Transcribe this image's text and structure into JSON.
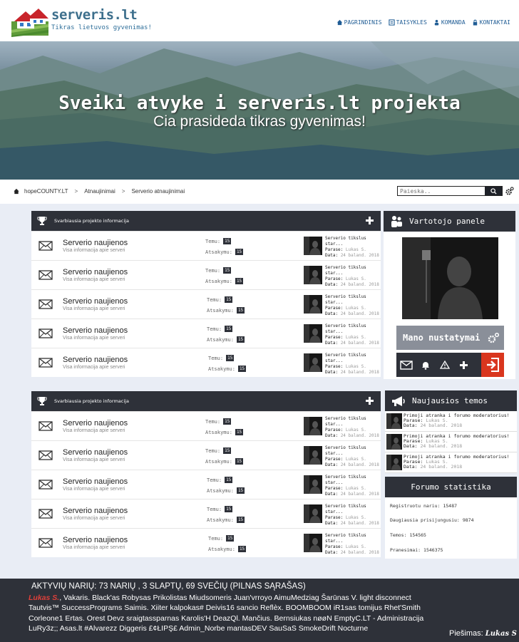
{
  "header": {
    "brand": "serveris.lt",
    "tagline": "Tikras lietuvos gyvenimas!",
    "nav": [
      {
        "label": "PAGRINDINIS",
        "icon": "home-icon"
      },
      {
        "label": "TAISYKLES",
        "icon": "rules-icon"
      },
      {
        "label": "KOMANDA",
        "icon": "team-icon"
      },
      {
        "label": "KONTAKTAI",
        "icon": "lock-icon"
      }
    ]
  },
  "hero": {
    "title": "Sveiki atvyke i serveris.lt projekta",
    "subtitle": "Cia prasideda tikras gyvenimas!"
  },
  "breadcrumb": [
    "hopeCOUNTY.LT",
    "Atnaujinimai",
    "Serverio atnaujinimai"
  ],
  "search": {
    "placeholder": "Paieska.."
  },
  "blocks": [
    {
      "title": "Svarbiausia projekto informacija",
      "rows": [
        {
          "title": "Serverio naujienos",
          "desc": "Visa informacija apie serveri",
          "topics_label": "Temu:",
          "topics": "15",
          "replies_label": "Atsakymu:",
          "replies": "15",
          "last_title": "Serverio tikslus star...",
          "by_label": "Parase:",
          "by": "Lukas S.",
          "date_label": "Data:",
          "date": "24 baland. 2018"
        },
        {
          "title": "Serverio naujienos",
          "desc": "Visa informacija apie serveri",
          "topics_label": "Temu:",
          "topics": "15",
          "replies_label": "Atsakymu:",
          "replies": "15",
          "last_title": "Serverio tikslus star...",
          "by_label": "Parase:",
          "by": "Lukas S.",
          "date_label": "Data:",
          "date": "24 baland. 2018"
        },
        {
          "title": "Serverio naujienos",
          "desc": "Visa informacija apie serveri",
          "topics_label": "Temu:",
          "topics": "15",
          "replies_label": "Atsakymu:",
          "replies": "15",
          "last_title": "Serverio tikslus star...",
          "by_label": "Parase:",
          "by": "Lukas S.",
          "date_label": "Data:",
          "date": "24 baland. 2018"
        },
        {
          "title": "Serverio naujienos",
          "desc": "Visa informacija apie serveri",
          "topics_label": "Temu:",
          "topics": "15",
          "replies_label": "Atsakymu:",
          "replies": "15",
          "last_title": "Serverio tikslus star...",
          "by_label": "Parase:",
          "by": "Lukas S.",
          "date_label": "Data:",
          "date": "24 baland. 2018"
        },
        {
          "title": "Serverio naujienos",
          "desc": "Visa informacija apie serveri",
          "topics_label": "Temu:",
          "topics": "15",
          "replies_label": "Atsakymu:",
          "replies": "15",
          "last_title": "Serverio tikslus star...",
          "by_label": "Parase:",
          "by": "Lukas S.",
          "date_label": "Data:",
          "date": "24 baland. 2018"
        }
      ]
    },
    {
      "title": "Svarbiausia projekto informacija",
      "rows": [
        {
          "title": "Serverio naujienos",
          "desc": "Visa informacija apie serveri",
          "topics_label": "Temu:",
          "topics": "15",
          "replies_label": "Atsakymu:",
          "replies": "15",
          "last_title": "Serverio tikslus star...",
          "by_label": "Parase:",
          "by": "Lukas S.",
          "date_label": "Data:",
          "date": "24 baland. 2018"
        },
        {
          "title": "Serverio naujienos",
          "desc": "Visa informacija apie serveri",
          "topics_label": "Temu:",
          "topics": "15",
          "replies_label": "Atsakymu:",
          "replies": "15",
          "last_title": "Serverio tikslus star...",
          "by_label": "Parase:",
          "by": "Lukas S.",
          "date_label": "Data:",
          "date": "24 baland. 2018"
        },
        {
          "title": "Serverio naujienos",
          "desc": "Visa informacija apie serveri",
          "topics_label": "Temu:",
          "topics": "15",
          "replies_label": "Atsakymu:",
          "replies": "15",
          "last_title": "Serverio tikslus star...",
          "by_label": "Parase:",
          "by": "Lukas S.",
          "date_label": "Data:",
          "date": "24 baland. 2018"
        },
        {
          "title": "Serverio naujienos",
          "desc": "Visa informacija apie serveri",
          "topics_label": "Temu:",
          "topics": "15",
          "replies_label": "Atsakymu:",
          "replies": "15",
          "last_title": "Serverio tikslus star...",
          "by_label": "Parase:",
          "by": "Lukas S.",
          "date_label": "Data:",
          "date": "24 baland. 2018"
        },
        {
          "title": "Serverio naujienos",
          "desc": "Visa informacija apie serveri",
          "topics_label": "Temu:",
          "topics": "15",
          "replies_label": "Atsakymu:",
          "replies": "15",
          "last_title": "Serverio tikslus star...",
          "by_label": "Parase:",
          "by": "Lukas S.",
          "date_label": "Data:",
          "date": "24 baland. 2018"
        }
      ]
    }
  ],
  "user_panel": {
    "title": "Vartotojo panele",
    "settings_label": "Mano nustatymai"
  },
  "latest": {
    "title": "Naujausios temos",
    "items": [
      {
        "title": "Primoji atranka i forumo moderatorius!",
        "by_label": "Parase:",
        "by": "Lukas S.",
        "date_label": "Data:",
        "date": "24 baland. 2018"
      },
      {
        "title": "Primoji atranka i forumo moderatorius!",
        "by_label": "Parase:",
        "by": "Lukas S.",
        "date_label": "Data:",
        "date": "24 baland. 2018"
      },
      {
        "title": "Primoji atranka i forumo moderatorius!",
        "by_label": "Parase:",
        "by": "Lukas S.",
        "date_label": "Data:",
        "date": "24 baland. 2018"
      }
    ]
  },
  "stats": {
    "title": "Forumo statistika",
    "items": [
      {
        "label": "Registruotu nariu:",
        "value": "15487"
      },
      {
        "label": "Daugiausia prisijungusiu:",
        "value": "9874"
      },
      {
        "label": "Temos:",
        "value": "154565"
      },
      {
        "label": "Pranesimai:",
        "value": "1546375"
      }
    ]
  },
  "footer": {
    "title": "AKTYVIŲ NARIŲ:   73 NARIŲ , 3 SLAPTŲ, 69 SVEČIŲ (PILNAS SĄRAŠAS)",
    "highlight": "Lukas S.",
    "line1": ", Vakaris. Black'as Robysas Prikolistas Miudsomeris Juan'vrroyo AimuMedziag Šarūnas V. light disconnect",
    "line2": "Tautvis™ SuccessPrograms Saimis. Xiiter kalpokas# Deivis16 sancio Reflèx. BOOMBOOM iR1sas tomijus Rhet'Smith",
    "line3": "Corleone1 Ertas. Orest Devz sraigtassparnas Karolis'H DeazQl. Mančius. Bernsiukas nøøN EmptyC.LT - Administracija",
    "line4": "LuRy3z;; Asas.lt #Alvarezz Diggeris £¢ŁIPŞ£ Admin_Norbe mantasDEV SauSaS SmokeDrift Nocturne",
    "drawn_label": "Piešimas:",
    "drawn_by": "Lukas S"
  }
}
